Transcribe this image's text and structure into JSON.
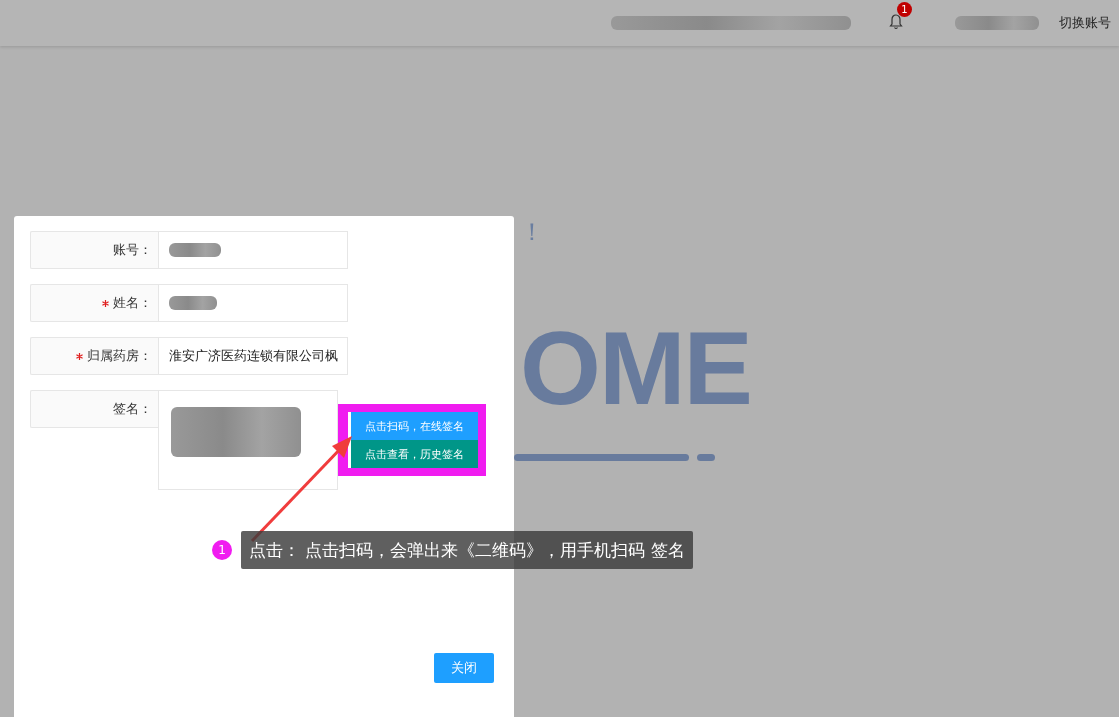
{
  "header": {
    "notification_count": "1",
    "switch_account": "切换账号"
  },
  "background": {
    "greeting_fragment": "！",
    "welcome_fragment": "OME"
  },
  "dialog": {
    "fields": [
      {
        "label": "账号：",
        "required": false,
        "kind": "redacted"
      },
      {
        "label": "姓名：",
        "required": true,
        "kind": "redacted"
      },
      {
        "label": "归属药房：",
        "required": true,
        "kind": "text",
        "value": "淮安广济医药连锁有限公司枫"
      },
      {
        "label": "签名：",
        "required": false,
        "kind": "signature"
      }
    ],
    "sign_buttons": [
      {
        "label": "点击扫码，在线签名",
        "kind": "primary"
      },
      {
        "label": "点击查看，历史签名",
        "kind": "secondary"
      }
    ],
    "close_button": "关闭"
  },
  "annotation": {
    "number": "1",
    "text": "点击： 点击扫码，会弹出来《二维码》，用手机扫码 签名"
  }
}
